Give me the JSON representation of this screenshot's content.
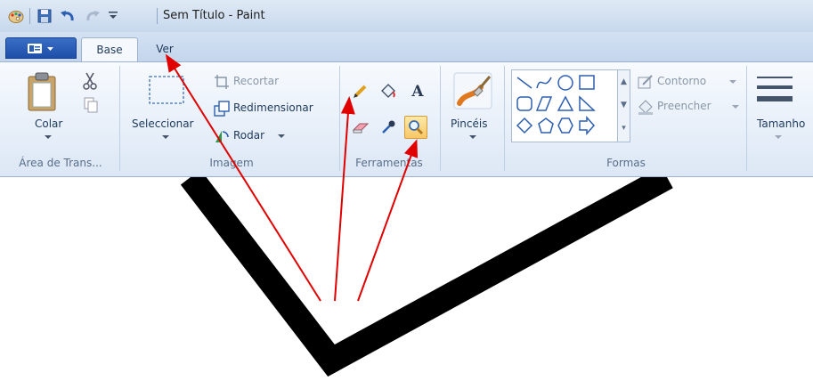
{
  "window": {
    "title": "Sem Título - Paint"
  },
  "quick_access": {
    "icons": [
      "paint-app-icon",
      "save-icon",
      "undo-icon",
      "redo-icon",
      "customize-toolbar-icon"
    ]
  },
  "tabs": [
    {
      "label": "Base",
      "active": true
    },
    {
      "label": "Ver",
      "active": false
    }
  ],
  "ribbon": {
    "clipboard": {
      "paste_label": "Colar",
      "group_label": "Área de Trans..."
    },
    "image": {
      "select_label": "Seleccionar",
      "crop_label": "Recortar",
      "resize_label": "Redimensionar",
      "rotate_label": "Rodar",
      "group_label": "Imagem"
    },
    "tools": {
      "items": [
        "pencil",
        "fill",
        "text",
        "eraser",
        "color-picker",
        "magnifier"
      ],
      "selected": "magnifier",
      "group_label": "Ferramentas"
    },
    "brushes": {
      "label": "Pincéis"
    },
    "shapes": {
      "outline_label": "Contorno",
      "fill_label": "Preencher",
      "group_label": "Formas"
    },
    "size": {
      "label": "Tamanho"
    }
  },
  "colors": {
    "accent_orange": "#f8c766",
    "annotation_arrow": "#e00000",
    "drawing_stroke": "#000000"
  }
}
